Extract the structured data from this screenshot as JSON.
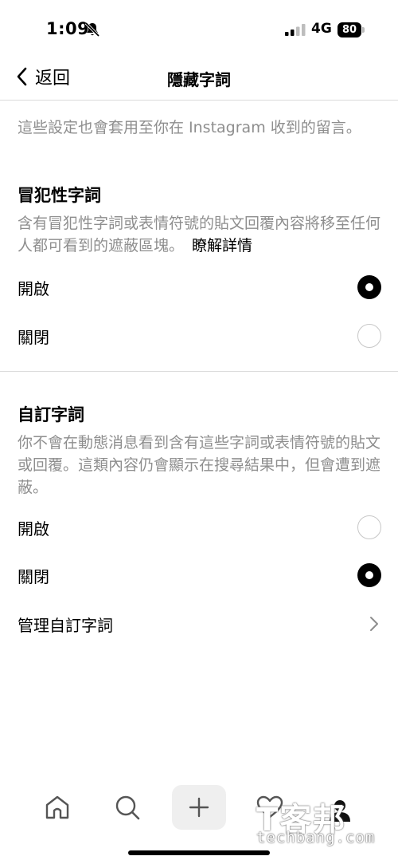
{
  "status": {
    "time": "1:09",
    "network": "4G",
    "battery": "80"
  },
  "nav": {
    "back_label": "返回",
    "title": "隱藏字詞"
  },
  "note": "這些設定也會套用至你在 Instagram 收到的留言。",
  "offensive": {
    "title": "冒犯性字詞",
    "description": "含有冒犯性字詞或表情符號的貼文回覆內容將移至任何人都可看到的遮蔽區塊。",
    "learn_more": "瞭解詳情",
    "options": [
      {
        "label": "開啟",
        "selected": true
      },
      {
        "label": "關閉",
        "selected": false
      }
    ]
  },
  "custom": {
    "title": "自訂字詞",
    "description": "你不會在動態消息看到含有這些字詞或表情符號的貼文或回覆。這類內容仍會顯示在搜尋結果中，但會遭到遮蔽。",
    "options": [
      {
        "label": "開啟",
        "selected": false
      },
      {
        "label": "關閉",
        "selected": true
      }
    ],
    "manage_label": "管理自訂字詞"
  },
  "tabs": [
    "home-icon",
    "search-icon",
    "create-icon",
    "heart-icon",
    "profile-icon"
  ],
  "watermark": {
    "logo": "T客邦",
    "url": "techbang.com"
  }
}
